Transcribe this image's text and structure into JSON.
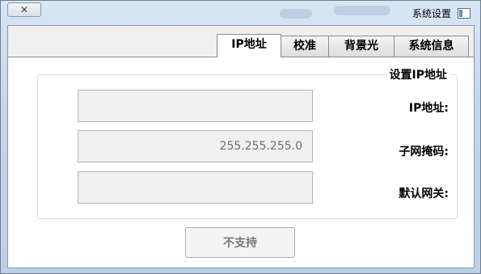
{
  "window": {
    "title": "系统设置",
    "close_glyph": "✕"
  },
  "tabs": [
    {
      "label": "系统信息",
      "active": false
    },
    {
      "label": "背景光",
      "active": false
    },
    {
      "label": "校准",
      "active": false
    },
    {
      "label": "IP地址",
      "active": true
    }
  ],
  "group": {
    "title": "设置IP地址",
    "fields": [
      {
        "label": "IP地址:",
        "value": ""
      },
      {
        "label": "子网掩码:",
        "value": "255.255.255.0"
      },
      {
        "label": "默认网关:",
        "value": ""
      }
    ]
  },
  "action_button": {
    "label": "不支持"
  },
  "colors": {
    "window_frame": "#cfdceb",
    "client_bg": "#f0f0f0",
    "panel_bg": "#ffffff",
    "field_bg": "#f0f0f0",
    "field_border": "#b4b4b4"
  }
}
